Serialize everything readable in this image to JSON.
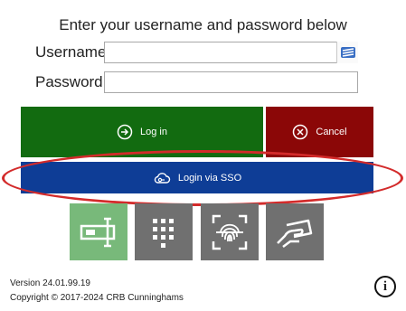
{
  "heading": "Enter your username and password below",
  "username": {
    "label": "Username",
    "value": "",
    "placeholder": ""
  },
  "password": {
    "label": "Password",
    "value": "",
    "placeholder": ""
  },
  "keyboard_icon": "on-screen-keyboard-icon",
  "buttons": {
    "login": {
      "label": "Log in",
      "icon": "login-arrow-icon",
      "color": "#126b10"
    },
    "cancel": {
      "label": "Cancel",
      "icon": "cancel-x-icon",
      "color": "#8b0707"
    },
    "sso": {
      "label": "Login via SSO",
      "icon": "cloud-key-icon",
      "color": "#0e3d96"
    }
  },
  "highlight_color": "#d32b2b",
  "login_methods": [
    {
      "icon": "card-reader-icon",
      "active": true,
      "color": "#78b97a"
    },
    {
      "icon": "keypad-icon",
      "active": false,
      "color": "#707070"
    },
    {
      "icon": "fingerprint-icon",
      "active": false,
      "color": "#707070"
    },
    {
      "icon": "hand-card-icon",
      "active": false,
      "color": "#707070"
    }
  ],
  "footer": {
    "version": "Version 24.01.99.19",
    "copyright": "Copyright © 2017-2024 CRB Cunninghams"
  },
  "info_icon": "info-icon"
}
